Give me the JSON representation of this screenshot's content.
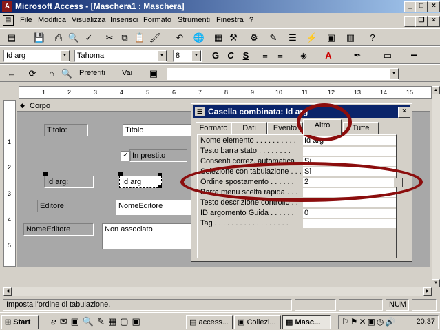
{
  "window": {
    "title": "Microsoft Access - [Maschera1 : Maschera]",
    "min": "_",
    "max": "□",
    "close": "×",
    "restore": "❐"
  },
  "menu": [
    "File",
    "Modifica",
    "Visualizza",
    "Inserisci",
    "Formato",
    "Strumenti",
    "Finestra",
    "?"
  ],
  "format_toolbar": {
    "object_combo": "Id arg",
    "font_combo": "Tahoma",
    "size_combo": "8",
    "bold": "G",
    "italic": "C",
    "underline": "S"
  },
  "web_toolbar": {
    "favorites": "Preferiti",
    "goto": "Vai"
  },
  "ruler": [
    "1",
    "2",
    "3",
    "4",
    "5",
    "6",
    "7",
    "8",
    "9",
    "10",
    "11",
    "12",
    "13",
    "14",
    "15"
  ],
  "vruler": [
    "1",
    "2",
    "3",
    "4",
    "5"
  ],
  "section": {
    "label": "Corpo"
  },
  "form": {
    "titolo_label": "Titolo:",
    "titolo_field": "Titolo",
    "prestito_label": "In prestito",
    "idarg_label": "Id arg:",
    "idarg_field": "Id arg",
    "editore_label": "Editore",
    "editore_field": "NomeEditore",
    "nomeeditore_label": "NomeEditore",
    "nomeeditore_field": "Non associato"
  },
  "properties": {
    "title": "Casella combinata: Id arg",
    "tabs": [
      "Formato",
      "Dati",
      "Evento",
      "Altro",
      "Tutte"
    ],
    "active_tab": "Altro",
    "rows": [
      {
        "name": "Nome elemento . . . . . . . . . .",
        "value": "Id arg"
      },
      {
        "name": "Testo barra stato . . . . . . . .",
        "value": ""
      },
      {
        "name": "Consenti correz. automatica . .",
        "value": "Sì"
      },
      {
        "name": "Selezione con tabulazione . . .",
        "value": "Sì"
      },
      {
        "name": "Ordine spostamento . . . . . .",
        "value": "2"
      },
      {
        "name": "Barra menu scelta rapida . . .",
        "value": ""
      },
      {
        "name": "Testo descrizione controllo . .",
        "value": ""
      },
      {
        "name": "ID argomento Guida . . . . . .",
        "value": "0"
      },
      {
        "name": "Tag . . . . . . . . . . . . . . . . . .",
        "value": ""
      }
    ],
    "builder": "..."
  },
  "status": {
    "text": "Imposta l'ordine di tabulazione.",
    "num": "NUM"
  },
  "taskbar": {
    "start": "Start",
    "tasks": [
      "access...",
      "Collezi...",
      "Masc..."
    ],
    "clock": "20.37"
  },
  "colors": {
    "title_start": "#0a246a",
    "title_end": "#a6caf0",
    "annotation": "#8b0d0d"
  }
}
